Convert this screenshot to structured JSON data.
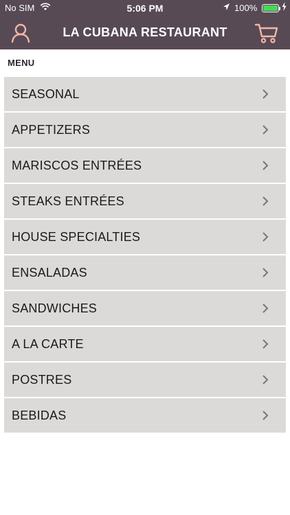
{
  "status_bar": {
    "carrier": "No SIM",
    "time": "5:06 PM",
    "battery": "100%",
    "battery_level": 1.0
  },
  "header": {
    "title": "LA CUBANA RESTAURANT",
    "accent_color": "#574a55",
    "icon_color": "#f3b7a6"
  },
  "menu": {
    "section_label": "MENU",
    "items": [
      {
        "label": "SEASONAL"
      },
      {
        "label": "APPETIZERS"
      },
      {
        "label": "MARISCOS ENTRÉES"
      },
      {
        "label": "STEAKS ENTRÉES"
      },
      {
        "label": "HOUSE SPECIALTIES"
      },
      {
        "label": "ENSALADAS"
      },
      {
        "label": "SANDWICHES"
      },
      {
        "label": "A LA CARTE"
      },
      {
        "label": "POSTRES"
      },
      {
        "label": "BEBIDAS"
      }
    ]
  }
}
